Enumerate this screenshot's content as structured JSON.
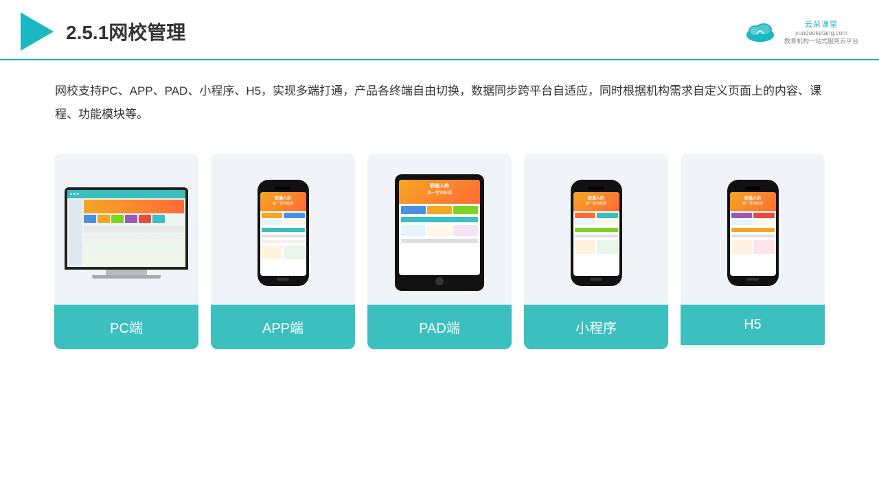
{
  "header": {
    "title": "2.5.1网校管理",
    "brand_name": "云朵课堂",
    "brand_domain": "yunduoketang.com",
    "brand_tagline_line1": "教育机构一站",
    "brand_tagline_line2": "式服务云平台"
  },
  "description": {
    "text": "网校支持PC、APP、PAD、小程序、H5，实现多端打通，产品各终端自由切换，数据同步跨平台自适应，同时根据机构需求自定义页面上的内容、课程、功能模块等。"
  },
  "cards": [
    {
      "id": "pc",
      "label": "PC端"
    },
    {
      "id": "app",
      "label": "APP端"
    },
    {
      "id": "pad",
      "label": "PAD端"
    },
    {
      "id": "miniprogram",
      "label": "小程序"
    },
    {
      "id": "h5",
      "label": "H5"
    }
  ],
  "colors": {
    "teal": "#3bbfbf",
    "accent": "#1ab8c4",
    "dark": "#333333"
  }
}
